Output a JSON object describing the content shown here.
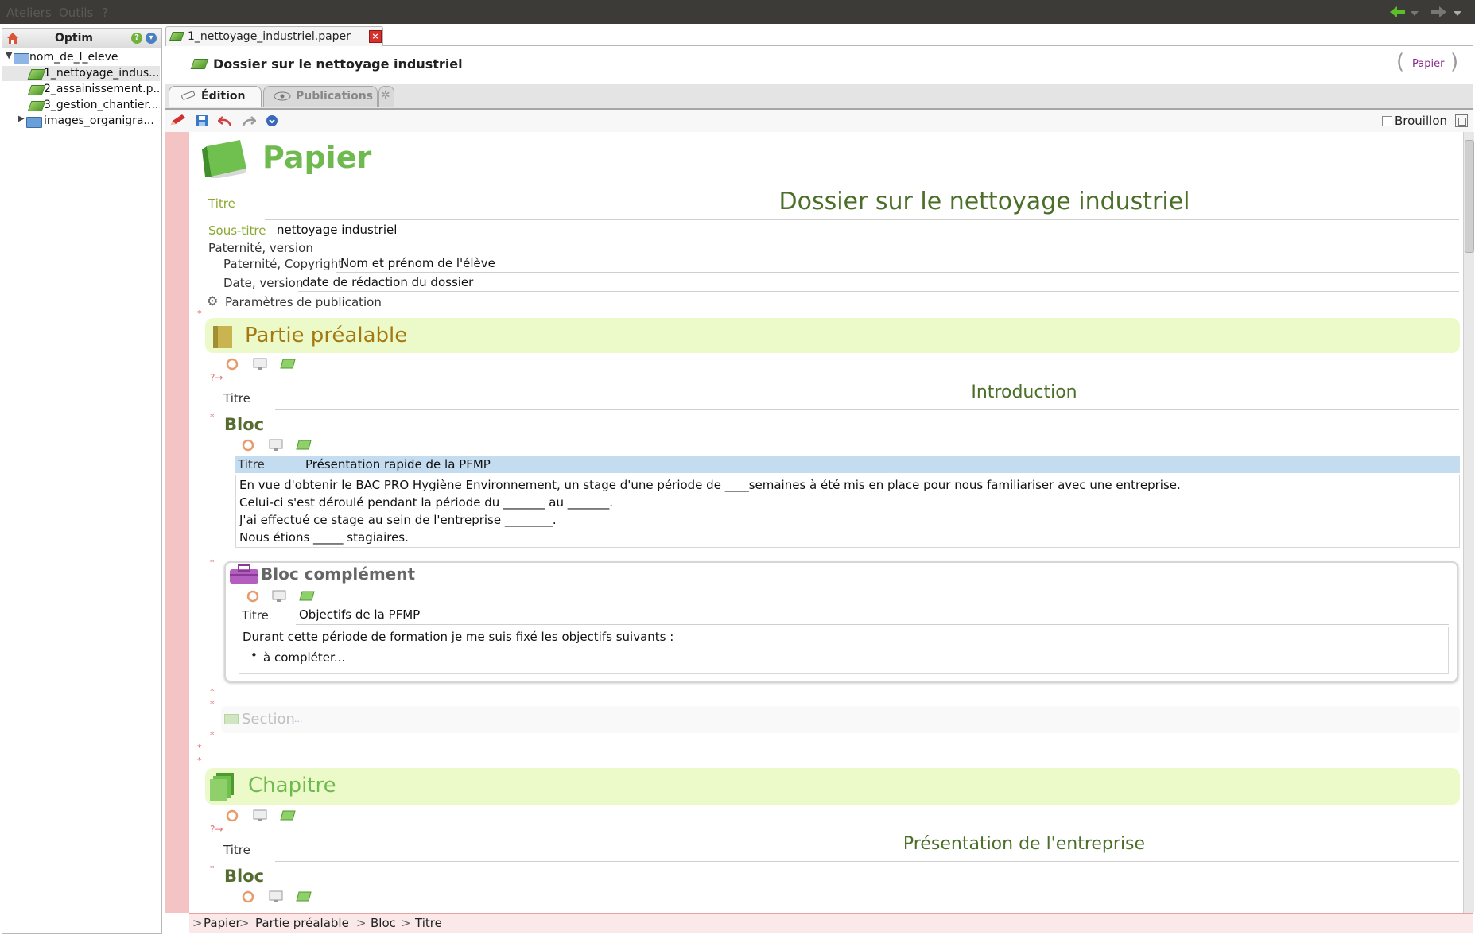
{
  "menubar": {
    "items": [
      "Ateliers",
      "Outils",
      "?"
    ]
  },
  "left_panel": {
    "title": "Optim",
    "tree": [
      {
        "label": "nom_de_l_eleve",
        "kind": "folder-open"
      },
      {
        "label": "1_nettoyage_indus...",
        "kind": "paper"
      },
      {
        "label": "2_assainissement.p...",
        "kind": "paper"
      },
      {
        "label": "3_gestion_chantier....",
        "kind": "paper"
      },
      {
        "label": "images_organigra...",
        "kind": "folder"
      }
    ]
  },
  "editor": {
    "tab_label": "1_nettoyage_industriel.paper",
    "doc_title": "Dossier sur le nettoyage industriel",
    "doc_type_badge": "Papier",
    "subtabs": {
      "edition": "Édition",
      "publications": "Publications"
    },
    "draft_label": "Brouillon"
  },
  "document": {
    "heading": "Papier",
    "titre_label": "Titre",
    "titre_value": "Dossier sur le nettoyage industriel",
    "soustitre_label": "Sous-titre",
    "soustitre_value": "nettoyage industriel",
    "paternite_label": "Paternité, version",
    "copyright_label": "Paternité, Copyright",
    "copyright_value": "Nom et prénom de l'élève",
    "date_label": "Date, version",
    "date_value": "date de rédaction du dossier",
    "params_label": "Paramètres de publication",
    "part1": {
      "heading": "Partie préalable",
      "titre_label": "Titre",
      "titre_value": "Introduction",
      "bloc_heading": "Bloc",
      "bloc_titre_label": "Titre",
      "bloc_titre_value": "Présentation rapide de la PFMP",
      "bloc_lines": [
        "En vue d'obtenir le BAC PRO Hygiène Environnement, un stage d'une période de ____semaines à été mis en place pour nous familiariser avec une entreprise.",
        "Celui-ci s'est déroulé pendant la période du _______ au _______.",
        "J'ai effectué ce stage au sein de l'entreprise ________.",
        "Nous étions _____ stagiaires."
      ],
      "complement_heading": "Bloc complément",
      "complement_titre_label": "Titre",
      "complement_titre_value": "Objectifs de la PFMP",
      "complement_intro": "Durant cette période de formation je me suis fixé les objectifs suivants :",
      "complement_bullet": "à compléter...",
      "section_placeholder": "Section",
      "section_dots": "..."
    },
    "chapter": {
      "heading": "Chapitre",
      "titre_label": "Titre",
      "titre_value": "Présentation de l'entreprise",
      "bloc_heading": "Bloc"
    }
  },
  "statusbar": {
    "crumbs": [
      "Papier",
      "Partie préalable",
      "Bloc",
      "Titre"
    ]
  },
  "colors": {
    "green_heading": "#6fba4e",
    "part_band": "#ecf9c9",
    "bloc_green": "#556b2f",
    "pink_gutter": "#f4c3c3",
    "selection_row": "#c4dcf0"
  }
}
